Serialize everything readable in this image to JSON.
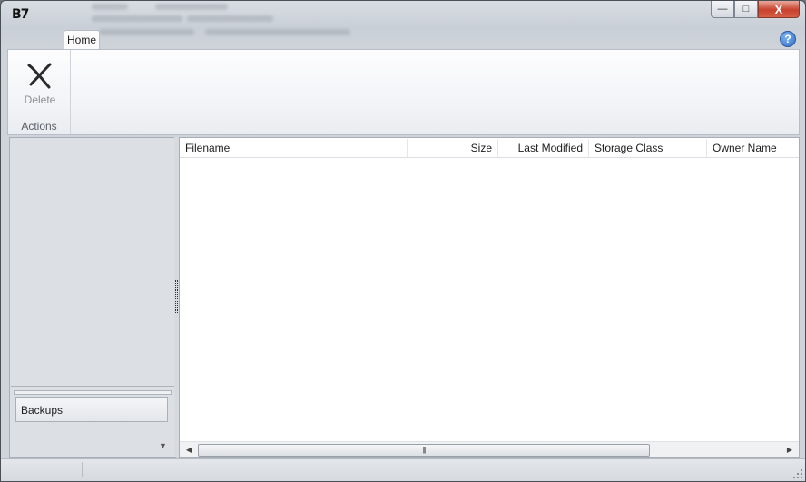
{
  "window": {
    "logo_text": "B7",
    "controls": {
      "minimize": "—",
      "maximize": "□",
      "close": "X"
    }
  },
  "ribbon": {
    "tabs": [
      {
        "label": "Home",
        "active": true
      }
    ],
    "help_icon": "?",
    "groups": [
      {
        "label": "Actions",
        "buttons": [
          {
            "label": "Delete",
            "icon": "delete-x-icon",
            "enabled": false
          }
        ]
      }
    ]
  },
  "left_pane": {
    "nav_items": [
      {
        "label": "Backups"
      }
    ]
  },
  "file_list": {
    "columns": [
      {
        "label": "Filename"
      },
      {
        "label": "Size"
      },
      {
        "label": "Last Modified"
      },
      {
        "label": "Storage Class"
      },
      {
        "label": "Owner Name"
      }
    ],
    "rows": []
  },
  "colors": {
    "accent_close": "#c8412c",
    "help_blue": "#2f6fc9",
    "pane_bg": "#dcdfe3"
  }
}
